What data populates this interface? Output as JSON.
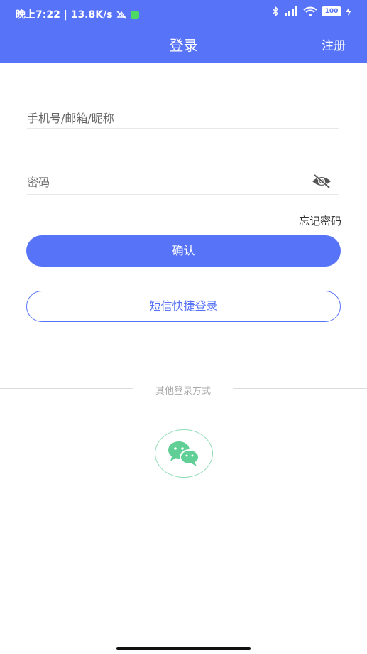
{
  "status_bar": {
    "time": "晚上7:22",
    "network_speed": "13.8K/s",
    "battery": "100"
  },
  "header": {
    "title": "登录",
    "register_label": "注册"
  },
  "form": {
    "account_placeholder": "手机号/邮箱/昵称",
    "password_placeholder": "密码",
    "forgot_label": "忘记密码",
    "confirm_label": "确认",
    "sms_login_label": "短信快捷登录"
  },
  "other_login": {
    "label": "其他登录方式",
    "methods": [
      "wechat-icon"
    ]
  },
  "colors": {
    "primary": "#5773f8",
    "wechat": "#5fcf95"
  }
}
